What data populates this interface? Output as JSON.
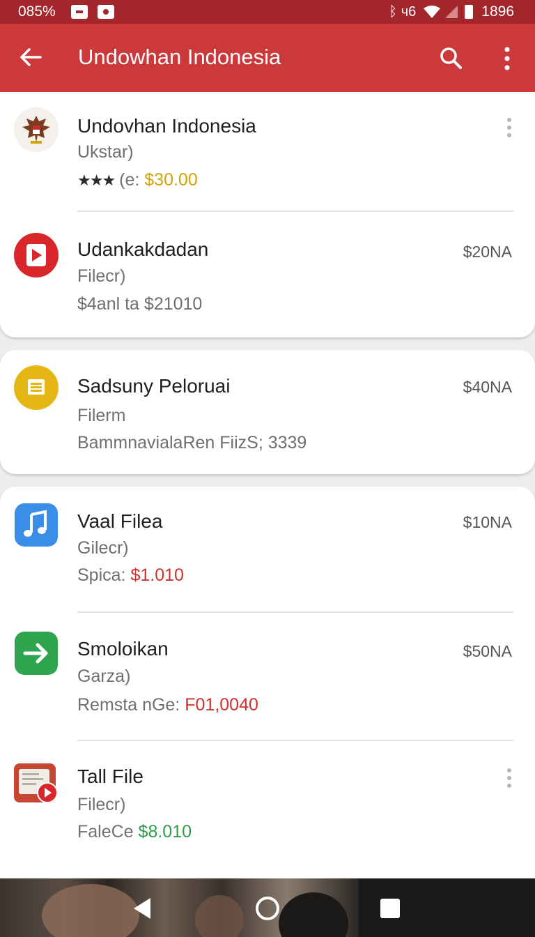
{
  "status_bar": {
    "battery_percent": "085%",
    "network": "ᛒ ч6",
    "time": "1896"
  },
  "app_bar": {
    "title": "Undowhan Indonesia",
    "color": "#cc393b"
  },
  "apps": [
    {
      "name": "Undovhan Indonesia",
      "subtitle": "Ukstar)",
      "meta_prefix": "(e:",
      "meta_value": "$30.00",
      "rating_display": "★★★",
      "price": "",
      "icon": "garuda-emblem-icon",
      "has_menu": true
    },
    {
      "name": "Udankakdadan",
      "subtitle": "Filecr)",
      "meta_prefix": "",
      "meta_value": "$4anl ta $21010",
      "price": "$20NA",
      "icon": "play-icon",
      "has_menu": false
    },
    {
      "name": "Sadsuny Peloruai",
      "subtitle": "Filerm",
      "meta_prefix": "BammnavialaRen FiizS; 3339",
      "meta_value": "",
      "price": "$40NA",
      "icon": "document-icon",
      "has_menu": false
    },
    {
      "name": "Vaal Filea",
      "subtitle": "Gilecr)",
      "meta_prefix": "Spica:",
      "meta_value": "$1.010",
      "price": "$10NA",
      "icon": "music-note-icon",
      "has_menu": false
    },
    {
      "name": "Smoloikan",
      "subtitle": "Garza)",
      "meta_prefix": "Remsta nGe:",
      "meta_value": "F01,0040",
      "price": "$50NA",
      "icon": "arrow-right-icon",
      "has_menu": false
    },
    {
      "name": "Tall File",
      "subtitle": "Filecr)",
      "meta_prefix": "FaleCe",
      "meta_value": "$8.010",
      "price": "",
      "icon": "video-file-icon",
      "has_menu": true
    }
  ]
}
